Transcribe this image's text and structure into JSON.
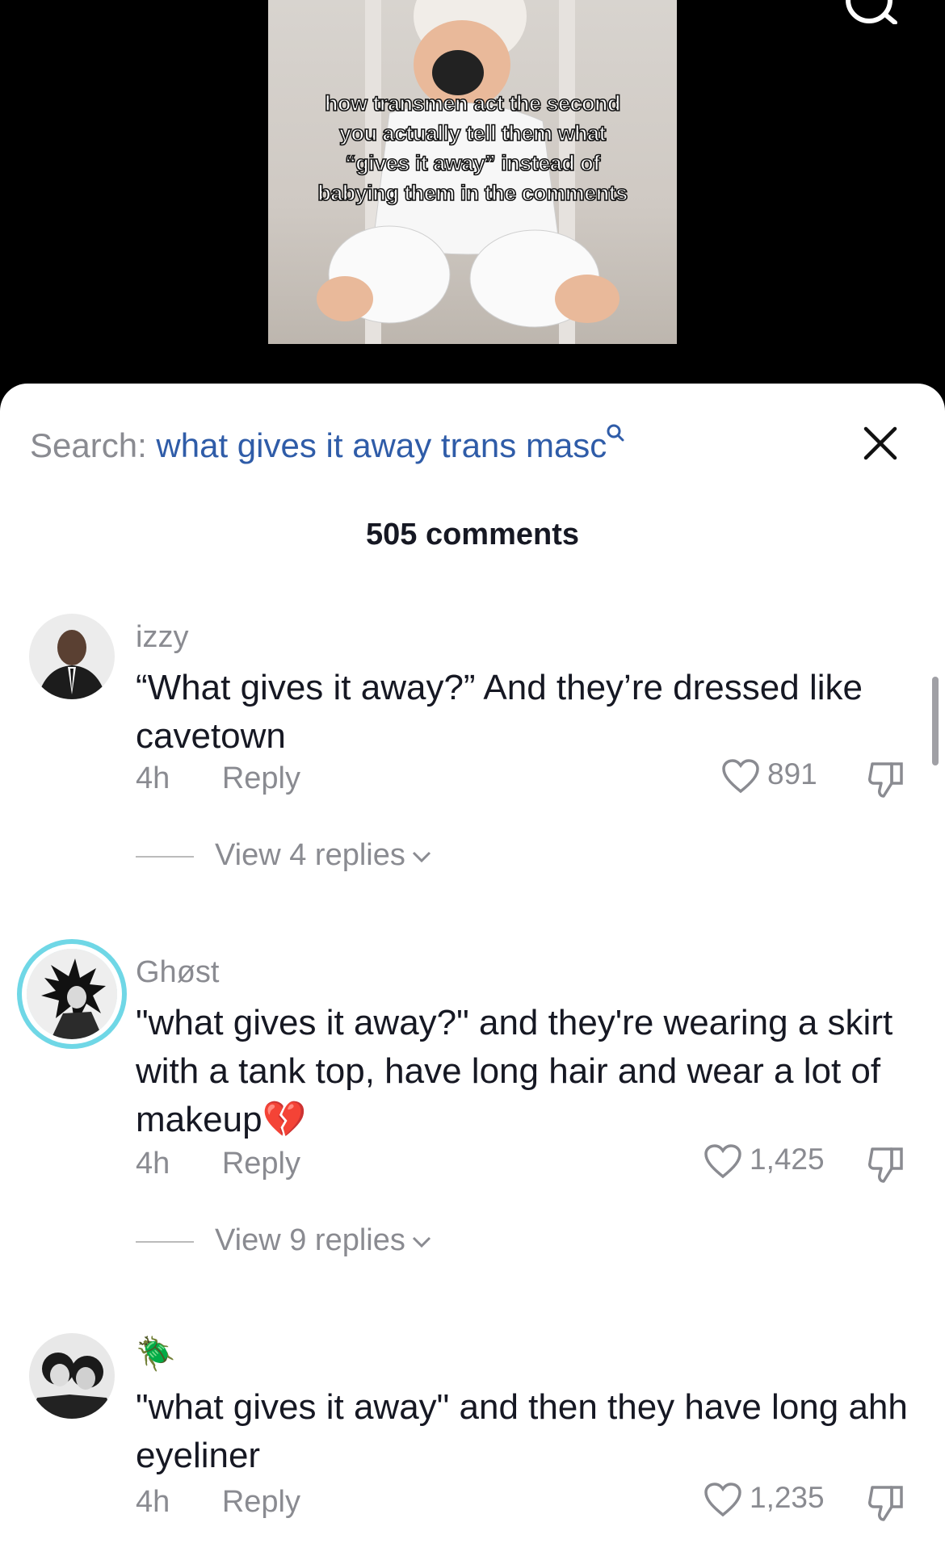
{
  "video": {
    "overlay_text": "how transmen act the second you actually tell them what “gives it away” instead of babying them in the comments"
  },
  "search": {
    "prefix": "Search:",
    "query": "what gives it away trans masc"
  },
  "comment_count": "505 comments",
  "comments": [
    {
      "username": "izzy",
      "text": "“What gives it away?” And they’re dressed like cavetown",
      "time": "4h",
      "reply": "Reply",
      "likes": "891",
      "view_replies": "View 4 replies"
    },
    {
      "username": "Ghøst",
      "text": "\"what gives it away?\" and they're wearing a skirt with a tank top, have long hair and wear a lot of makeup💔",
      "time": "4h",
      "reply": "Reply",
      "likes": "1,425",
      "view_replies": "View 9 replies"
    },
    {
      "username": "🪲",
      "text": "\"what gives it away\" and then they have long ahh eyeliner",
      "time": "4h",
      "reply": "Reply",
      "likes": "1,235"
    }
  ],
  "colors": {
    "link": "#2f5ca8",
    "muted": "#8a8b91",
    "text": "#161823",
    "ring": "#6fd7e6"
  }
}
